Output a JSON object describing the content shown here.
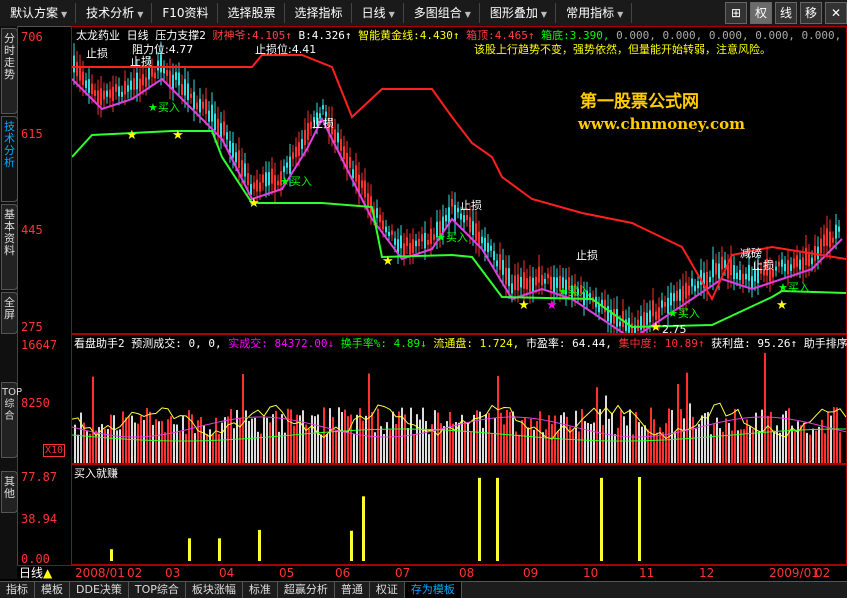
{
  "toolbar": {
    "items": [
      {
        "label": "默认方案"
      },
      {
        "label": "技术分析"
      },
      {
        "label": "F10资料"
      },
      {
        "label": "选择股票"
      },
      {
        "label": "选择指标"
      },
      {
        "label": "日线"
      },
      {
        "label": "多图组合"
      },
      {
        "label": "图形叠加"
      },
      {
        "label": "常用指标"
      }
    ],
    "right_icons": [
      {
        "label": "⊞",
        "name": "grid-icon"
      },
      {
        "label": "权",
        "name": "weight-button"
      },
      {
        "label": "线",
        "name": "line-button"
      },
      {
        "label": "移",
        "name": "move-button"
      },
      {
        "label": "✕",
        "name": "close-icon"
      }
    ]
  },
  "sidebar": {
    "tabs": [
      {
        "label": "分时走势"
      },
      {
        "label": "技术分析"
      },
      {
        "label": "基本资料"
      },
      {
        "label": "全屏"
      },
      {
        "label": "TOP综合"
      },
      {
        "label": "其他"
      }
    ]
  },
  "main": {
    "stock": "太龙药业",
    "period": "日线",
    "indicator": "压力支撑2",
    "fields": [
      {
        "k": "财神爷:",
        "v": "4.105↑",
        "color": "#ff4040"
      },
      {
        "k": "B:",
        "v": "4.326↑",
        "color": "#ffffff"
      },
      {
        "k": "智能黄金线:",
        "v": "4.430↑",
        "color": "#ffff00"
      },
      {
        "k": "箱顶:",
        "v": "4.465↑",
        "color": "#ff4040"
      },
      {
        "k": "箱底:",
        "v": "3.390,",
        "color": "#00ff00"
      }
    ],
    "tail_values": "0.000, 0.000, 0.000, 0.000, 0.000,",
    "tip": "该股上行趋势不变，强势依然，但量能开始转弱，注意风险。",
    "watermark1": "第一股票公式网",
    "watermark2": "www.chnmoney.com",
    "y_labels": [
      "706",
      "615",
      "445",
      "275"
    ],
    "annotations": {
      "stop": "止损",
      "buy": "买入",
      "resist": "阻力位:4.77",
      "stoppos": "止损位:4.41",
      "reduce": "减磅",
      "low": "2.75"
    }
  },
  "volume": {
    "title": "看盘助手2",
    "pred": "预测成交: 0, 0,",
    "real": "实成交: 84372.00↓",
    "turnover": "换手率%: 4.89↓",
    "float": "流通盘: 1.724,",
    "pe": "市盈率: 64.44,",
    "conc": "集中度: 10.89↑",
    "profit": "获利盘: 95.26↑",
    "helper": "助手排序",
    "y_labels": [
      "16647",
      "8250",
      "X10"
    ]
  },
  "buy": {
    "title": "买入就赚",
    "y_labels": [
      "77.87",
      "38.94",
      "0.00"
    ],
    "bars": [
      0.14,
      0.27,
      0.27,
      0.37,
      0.36,
      0.77,
      0.99,
      0.99,
      0.99,
      1.0
    ]
  },
  "dates": {
    "period": "日线",
    "labels": [
      "2008/01",
      "02",
      "03",
      "04",
      "05",
      "06",
      "07",
      "08",
      "09",
      "10",
      "11",
      "12",
      "2009/01",
      "02"
    ]
  },
  "bottom_tabs": [
    {
      "label": "指标"
    },
    {
      "label": "模板"
    },
    {
      "label": "DDE决策"
    },
    {
      "label": "TOP综合"
    },
    {
      "label": "板块涨幅"
    },
    {
      "label": "标准"
    },
    {
      "label": "超赢分析"
    },
    {
      "label": "普通"
    },
    {
      "label": "权证"
    },
    {
      "label": "存为模板"
    }
  ]
}
